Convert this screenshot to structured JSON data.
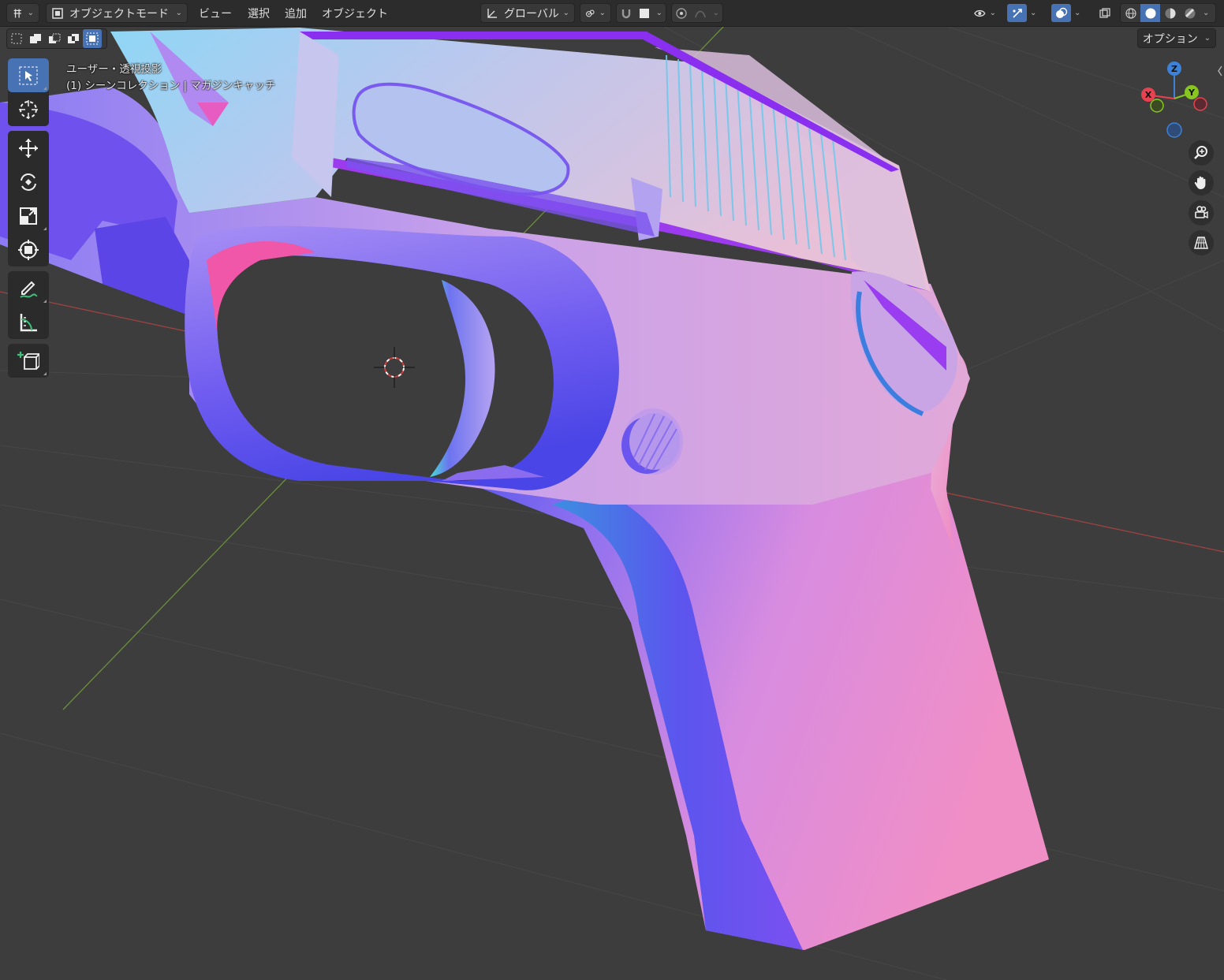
{
  "header": {
    "editor_type_icon": "viewport-editor-icon",
    "mode": {
      "label": "オブジェクトモード",
      "icon": "object-mode-icon"
    },
    "menus": [
      "ビュー",
      "選択",
      "追加",
      "オブジェクト"
    ],
    "transform_orientation": {
      "label": "グローバル",
      "icon": "orientation-axes-icon"
    },
    "pivot_icon": "pivot-point-icon",
    "snap_icon": "snap-magnet-icon",
    "snap_target_icon": "snap-target-icon",
    "proportional_icon": "proportional-edit-icon",
    "proportional_falloff_icon": "falloff-curve-icon",
    "visibility_icon": "eye-visibility-icon",
    "gizmo_icon": "gizmo-toggle-icon",
    "overlay_icon": "overlay-toggle-icon",
    "xray_icon": "xray-toggle-icon",
    "shading_modes": [
      "wireframe-shading-icon",
      "solid-shading-icon",
      "material-preview-icon",
      "rendered-shading-icon"
    ],
    "active_shading": 1
  },
  "selection_modes": {
    "icons": [
      "select-new-icon",
      "select-extend-icon",
      "select-subtract-icon",
      "select-difference-icon",
      "select-intersect-icon"
    ],
    "active": 4
  },
  "options": {
    "label": "オプション"
  },
  "viewport_info": {
    "view_name": "ユーザー・透視投影",
    "collection": "(1) シーンコレクション | マガジンキャッチ"
  },
  "toolbar": {
    "tools": [
      {
        "name": "select-box-tool",
        "icon": "select-box-icon",
        "active": true
      },
      {
        "name": "cursor-tool",
        "icon": "cursor-icon",
        "active": false
      },
      {
        "name": "move-tool",
        "icon": "move-icon",
        "active": false
      },
      {
        "name": "rotate-tool",
        "icon": "rotate-icon",
        "active": false
      },
      {
        "name": "scale-tool",
        "icon": "scale-icon",
        "active": false
      },
      {
        "name": "transform-tool",
        "icon": "transform-icon",
        "active": false
      },
      {
        "name": "annotate-tool",
        "icon": "annotate-icon",
        "active": false
      },
      {
        "name": "measure-tool",
        "icon": "measure-icon",
        "active": false
      },
      {
        "name": "add-cube-tool",
        "icon": "add-cube-icon",
        "active": false
      }
    ]
  },
  "gizmo": {
    "axes": [
      "Z",
      "Y",
      "X"
    ],
    "colors": {
      "x": "#e8414f",
      "y": "#88c520",
      "z": "#3b82d8"
    }
  },
  "nav_buttons": [
    "zoom-icon",
    "pan-hand-icon",
    "camera-view-icon",
    "orthographic-grid-icon"
  ],
  "colors": {
    "viewport_bg": "#3d3d3d",
    "header_bg": "#2c2c2c",
    "accent": "#4772b3"
  }
}
